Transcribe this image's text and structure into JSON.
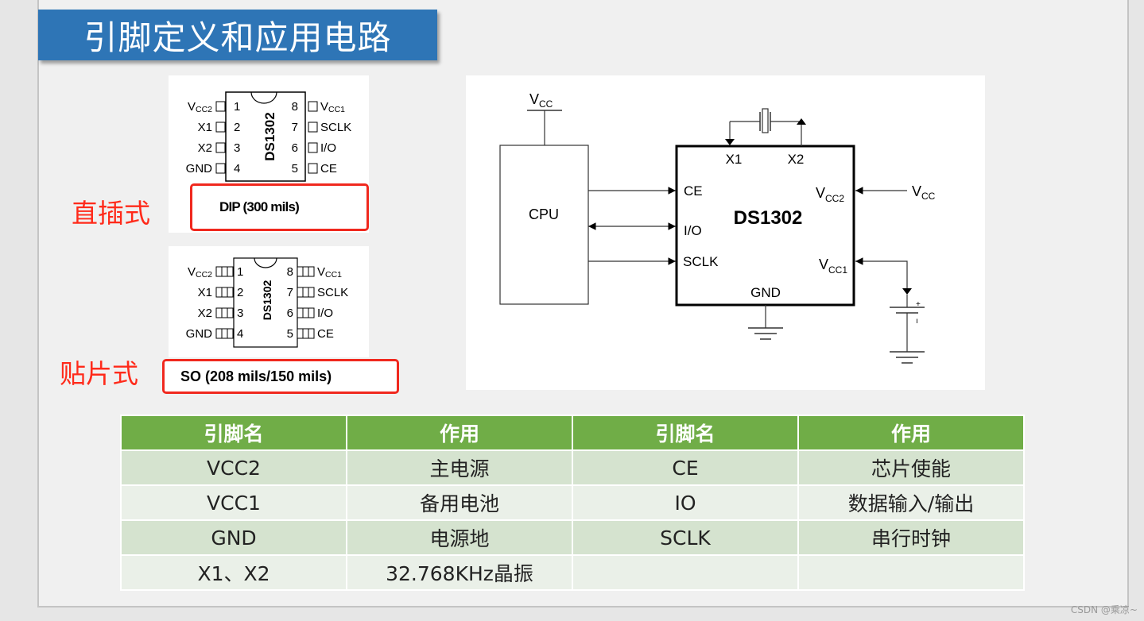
{
  "slide": {
    "title": "引脚定义和应用电路",
    "colors": {
      "banner": "#2e75b6",
      "label_red": "#ff2a1a",
      "table_header": "#70ad47",
      "table_row_odd": "#d5e3cf",
      "table_row_even": "#eaf0e8"
    }
  },
  "packages": {
    "dip": {
      "label": "直插式",
      "chip_name": "DS1302",
      "caption": "DIP (300 mils)",
      "left_pins": [
        {
          "num": "1",
          "name": "V",
          "sub": "CC2"
        },
        {
          "num": "2",
          "name": "X1",
          "sub": ""
        },
        {
          "num": "3",
          "name": "X2",
          "sub": ""
        },
        {
          "num": "4",
          "name": "GND",
          "sub": ""
        }
      ],
      "right_pins": [
        {
          "num": "8",
          "name": "V",
          "sub": "CC1"
        },
        {
          "num": "7",
          "name": "SCLK",
          "sub": ""
        },
        {
          "num": "6",
          "name": "I/O",
          "sub": ""
        },
        {
          "num": "5",
          "name": "CE",
          "sub": ""
        }
      ]
    },
    "so": {
      "label": "贴片式",
      "chip_name": "DS1302",
      "caption": "SO (208 mils/150 mils)",
      "left_pins": [
        {
          "num": "1",
          "name": "V",
          "sub": "CC2"
        },
        {
          "num": "2",
          "name": "X1",
          "sub": ""
        },
        {
          "num": "3",
          "name": "X2",
          "sub": ""
        },
        {
          "num": "4",
          "name": "GND",
          "sub": ""
        }
      ],
      "right_pins": [
        {
          "num": "8",
          "name": "V",
          "sub": "CC1"
        },
        {
          "num": "7",
          "name": "SCLK",
          "sub": ""
        },
        {
          "num": "6",
          "name": "I/O",
          "sub": ""
        },
        {
          "num": "5",
          "name": "CE",
          "sub": ""
        }
      ]
    }
  },
  "circuit": {
    "cpu_label": "CPU",
    "vcc_top": {
      "name": "V",
      "sub": "CC"
    },
    "chip_name": "DS1302",
    "chip_pins_left": [
      "CE",
      "I/O",
      "SCLK"
    ],
    "chip_pins_top": [
      "X1",
      "X2"
    ],
    "chip_pin_bottom": "GND",
    "vcc2": {
      "name": "V",
      "sub": "CC2"
    },
    "vcc1": {
      "name": "V",
      "sub": "CC1"
    },
    "vcc_right": {
      "name": "V",
      "sub": "CC"
    },
    "battery_plus": "+",
    "battery_minus": "ı"
  },
  "table": {
    "headers": [
      "引脚名",
      "作用",
      "引脚名",
      "作用"
    ],
    "rows": [
      [
        "VCC2",
        "主电源",
        "CE",
        "芯片使能"
      ],
      [
        "VCC1",
        "备用电池",
        "IO",
        "数据输入/输出"
      ],
      [
        "GND",
        "电源地",
        "SCLK",
        "串行时钟"
      ],
      [
        "X1、X2",
        "32.768KHz晶振",
        "",
        ""
      ]
    ]
  },
  "watermark": "CSDN @乘凉~"
}
